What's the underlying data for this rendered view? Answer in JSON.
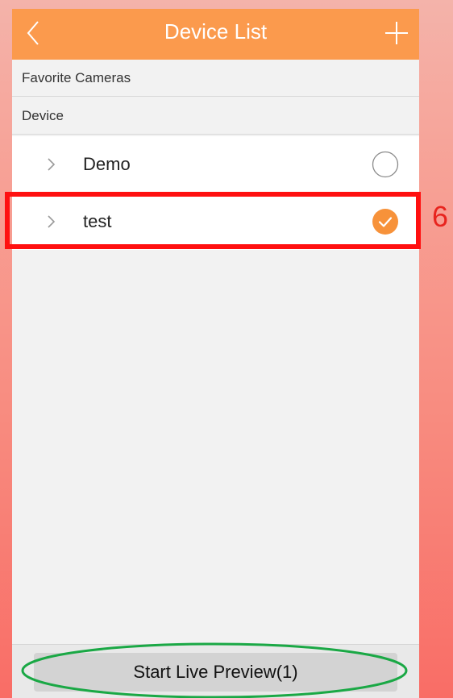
{
  "header": {
    "title": "Device List",
    "back_icon": "chevron-left-icon",
    "add_icon": "plus-icon",
    "color": "#fb9a4d"
  },
  "sections": {
    "favorites_label": "Favorite Cameras",
    "device_label": "Device"
  },
  "devices": [
    {
      "name": "Demo",
      "selected": false
    },
    {
      "name": "test",
      "selected": true
    }
  ],
  "annotation": {
    "step_number": "6",
    "highlight_color": "#ff1010",
    "ellipse_color": "#1aa845"
  },
  "bottom": {
    "start_label": "Start Live Preview(1)"
  },
  "accent_color": "#f7923a"
}
